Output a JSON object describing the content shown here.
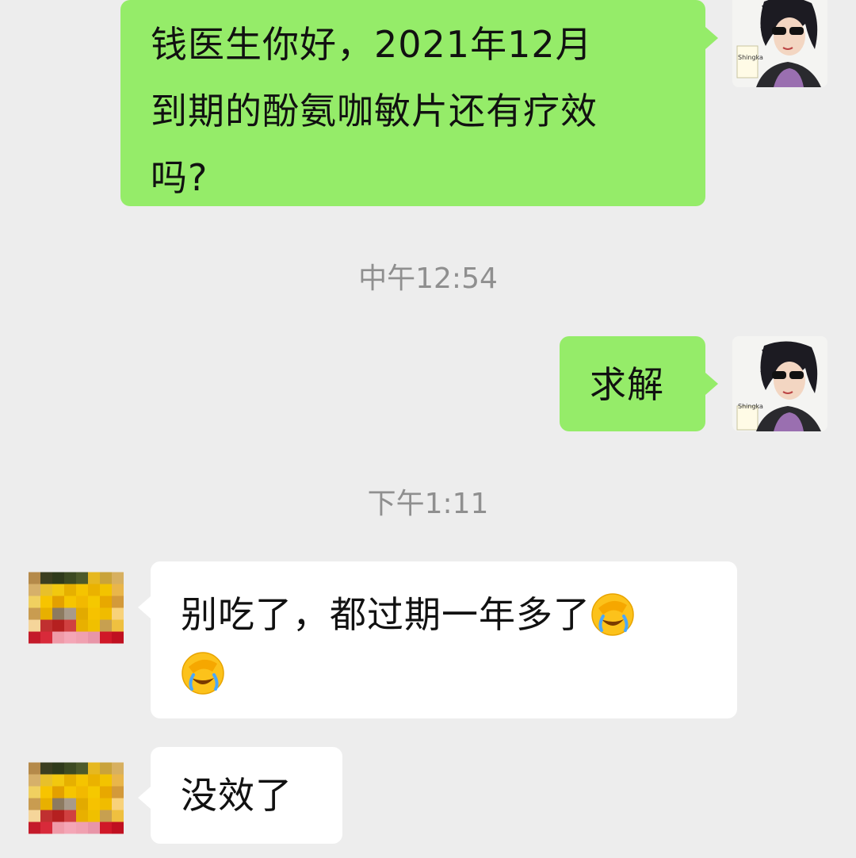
{
  "messages": [
    {
      "side": "sent",
      "text_lines": [
        "钱医生你好，2021年12月",
        "到期的酚氨咖敏片还有疗效",
        "吗?"
      ]
    },
    {
      "side": "sent",
      "text": "求解"
    },
    {
      "side": "received",
      "text": "别吃了，都过期一年多了",
      "emojis": [
        "facepalm-laugh",
        "facepalm-laugh"
      ]
    },
    {
      "side": "received",
      "text": "没效了"
    }
  ],
  "timestamps": {
    "noon": "中午12:54",
    "afternoon": "下午1:11"
  },
  "avatars": {
    "me_caption": "Shingka"
  },
  "colors": {
    "background": "#ededed",
    "sent_bubble": "#95ec69",
    "received_bubble": "#ffffff",
    "timestamp": "#8f8f8f"
  }
}
